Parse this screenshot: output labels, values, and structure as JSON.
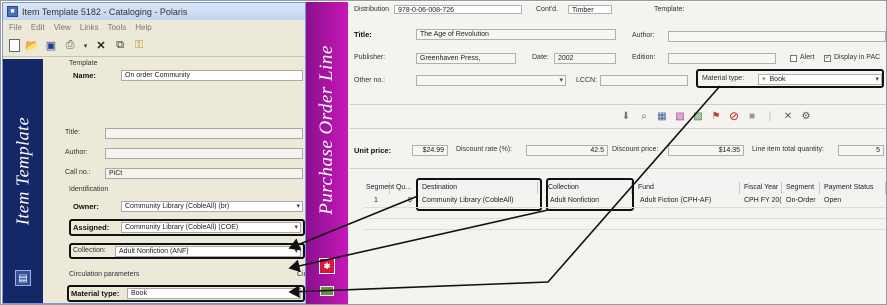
{
  "left_window": {
    "title": "Item Template 5182 - Cataloging - Polaris",
    "menu": [
      "File",
      "Edit",
      "View",
      "Links",
      "Tools",
      "Help"
    ],
    "sidebar_label": "Item Template",
    "template_section": "Template",
    "name_label": "Name:",
    "name_value": "On order Community",
    "title_label": "Title:",
    "title_value": "",
    "author_label": "Author:",
    "author_value": "",
    "callno_label": "Call no.:",
    "callno_value": "PiCt",
    "identification_label": "Identification",
    "owner_label": "Owner:",
    "owner_value": "Community Library (CobleAll) (br)",
    "assigned_label": "Assigned:",
    "assigned_value": "Community Library (CobleAll) (COE)",
    "collection_label": "Collection:",
    "collection_value": "Adult Nonfiction (ANF)",
    "circulation_label": "Circulation parameters",
    "circulation_tail": "Cir",
    "material_type_label": "Material type:",
    "material_type_value": "Book"
  },
  "right_window": {
    "sidebar_label": "Purchase Order Line",
    "top_partial_left": "Distribution",
    "top_partial_value": "978-0-06-008-726",
    "top_partial_mid": "Cont'd.",
    "top_partial_mid_value": "Timber",
    "top_partial_right": "Template:",
    "title_label": "Title:",
    "title_value": "The Age of Revolution",
    "author_label": "Author:",
    "author_value": "",
    "publisher_label": "Publisher:",
    "publisher_value": "Greenhaven Press,",
    "date_label": "Date:",
    "date_value": "2002",
    "edition_label": "Edition:",
    "edition_value": "",
    "alert_label": "Alert",
    "display_label": "Display in PAC",
    "otherno_label": "Other no.:",
    "lccn_label": "LCCN:",
    "material_type_label": "Material type:",
    "material_type_value": "Book",
    "unit_price_label": "Unit price:",
    "unit_price_value": "$24.99",
    "discount_rate_label": "Discount rate (%):",
    "discount_rate_value": "42.5",
    "discount_price_label": "Discount price:",
    "discount_price_value": "$14.35",
    "line_total_label": "Line item total quantity:",
    "line_total_value": "5",
    "grid_headers": [
      "Segment Qu...",
      "Destination",
      "Collection",
      "Fund",
      "Fiscal Year",
      "Segment",
      "Payment Status"
    ],
    "grid_row": [
      "1",
      "5",
      "Community Library (CobleAll)",
      "Adult Nonfiction",
      "Adult Fiction (CPH-AF)",
      "CPH FY 20(",
      "On-Order",
      "Open"
    ]
  },
  "colors": {
    "left_sidebar": "#142868",
    "right_sidebar": "#b01aa8",
    "window_bg": "#ece9d8"
  }
}
